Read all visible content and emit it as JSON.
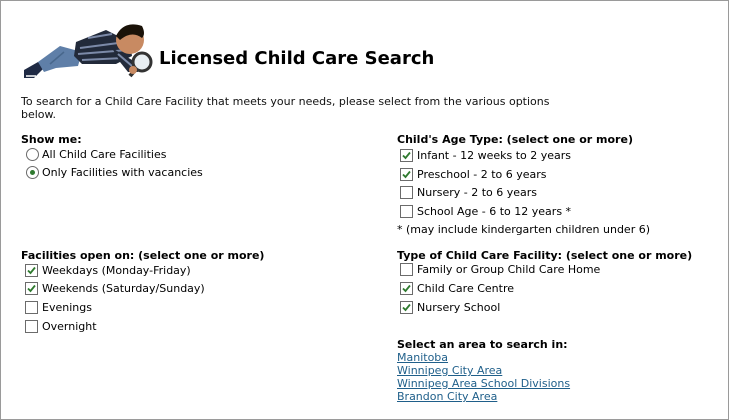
{
  "header": {
    "title": "Licensed Child Care Search"
  },
  "intro": "To search for a Child Care Facility that meets your needs, please select from the various options below.",
  "show_me": {
    "title": "Show me:",
    "options": [
      {
        "label": "All Child Care Facilities",
        "selected": false
      },
      {
        "label": "Only Facilities with vacancies",
        "selected": true
      }
    ]
  },
  "age_type": {
    "title": "Child's Age Type: (select one or more)",
    "options": [
      {
        "label": "Infant - 12 weeks to 2 years",
        "checked": true
      },
      {
        "label": "Preschool - 2 to 6 years",
        "checked": true
      },
      {
        "label": "Nursery - 2 to 6 years",
        "checked": false
      },
      {
        "label": "School Age - 6 to 12 years *",
        "checked": false
      }
    ],
    "note": "* (may include kindergarten children under 6)"
  },
  "open_on": {
    "title": "Facilities open on: (select one or more)",
    "options": [
      {
        "label": "Weekdays (Monday-Friday)",
        "checked": true
      },
      {
        "label": "Weekends (Saturday/Sunday)",
        "checked": true
      },
      {
        "label": "Evenings",
        "checked": false
      },
      {
        "label": "Overnight",
        "checked": false
      }
    ]
  },
  "facility_type": {
    "title": "Type of Child Care Facility: (select one or more)",
    "options": [
      {
        "label": "Family or Group Child Care Home",
        "checked": false
      },
      {
        "label": "Child Care Centre",
        "checked": true
      },
      {
        "label": "Nursery School",
        "checked": true
      }
    ]
  },
  "area": {
    "title": "Select an area to search in:",
    "links": [
      "Manitoba",
      "Winnipeg City Area",
      "Winnipeg Area School Divisions",
      "Brandon City Area"
    ]
  },
  "colors": {
    "link": "#1f5f8a",
    "check": "#2f7a2f",
    "border": "#9a9a9a"
  }
}
